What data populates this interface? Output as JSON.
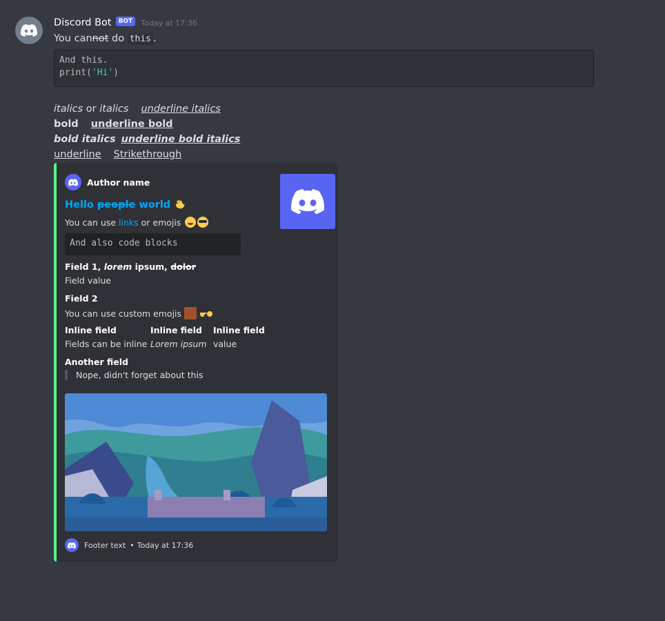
{
  "message": {
    "username": "Discord Bot",
    "bot_tag": "BOT",
    "timestamp": "Today at 17:36",
    "line1": {
      "part1": "You can",
      "struck": "not",
      "part2": " do ",
      "code": "this",
      "part3": "."
    },
    "code_block": {
      "line1": "And this.",
      "line2_prefix": "print(",
      "line2_string": "'Hi'",
      "line2_suffix": ")"
    },
    "formatting": {
      "italics1": "italics",
      "or": " or ",
      "italics2": "italics",
      "underline_italics": "underline italics",
      "bold": "bold",
      "underline_bold": "underline bold",
      "bold_italics": "bold italics",
      "underline_bold_italics": "underline bold italics",
      "underline": "underline",
      "strikethrough": "Strikethrough"
    }
  },
  "embed": {
    "accent_color": "#57f287",
    "author_name": "Author name",
    "title": {
      "part1": "Hello ",
      "struck": "people",
      "part2": " world"
    },
    "description": {
      "part1": "You can use ",
      "link": "links",
      "part2": " or emojis"
    },
    "code": "And also code blocks",
    "fields": [
      {
        "name_bold": "Field 1, ",
        "name_italic": "lorem",
        "name_mid": " ipsum, ",
        "name_struck": "dolor",
        "value": "Field value"
      },
      {
        "name": "Field 2",
        "value": "You can use custom emojis "
      },
      {
        "name": "Inline field",
        "value": "Fields can be inline"
      },
      {
        "name": "Inline field",
        "value": "Lorem ipsum"
      },
      {
        "name": "Inline field",
        "value": "value"
      },
      {
        "name": "Another field",
        "value": "Nope, didn't forget about this"
      }
    ],
    "footer": {
      "text": "Footer text",
      "separator": "•",
      "timestamp": "Today at 17:36"
    }
  }
}
